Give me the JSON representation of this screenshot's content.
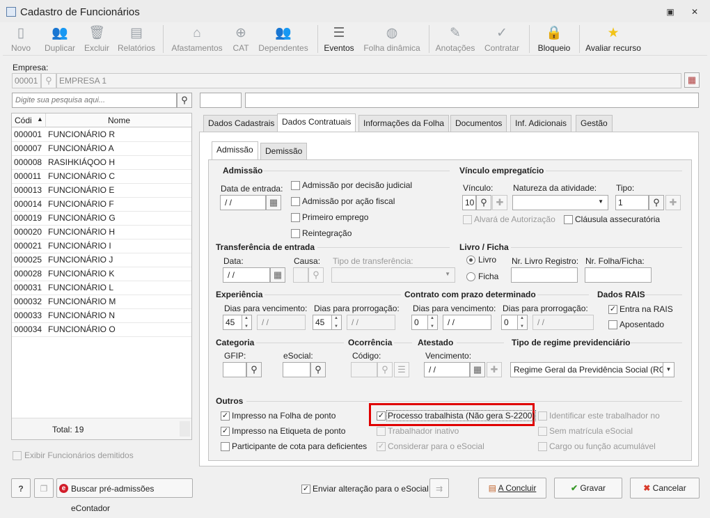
{
  "window": {
    "title": "Cadastro de Funcionários",
    "restore_icon": "▣",
    "close_icon": "✕"
  },
  "toolbar": [
    {
      "label": "Novo",
      "icon": "new-doc-icon",
      "glyph": "▯"
    },
    {
      "label": "Duplicar",
      "icon": "users-icon",
      "glyph": "👥"
    },
    {
      "label": "Excluir",
      "icon": "trash-icon",
      "glyph": "🗑"
    },
    {
      "label": "Relatórios",
      "icon": "report-icon",
      "glyph": "▤"
    },
    {
      "label": "Afastamentos",
      "icon": "house-arrow-icon",
      "glyph": "⌂"
    },
    {
      "label": "CAT",
      "icon": "plus-circle-icon",
      "glyph": "⊕"
    },
    {
      "label": "Dependentes",
      "icon": "people-icon",
      "glyph": "👥"
    },
    {
      "label": "Eventos",
      "icon": "list-icon",
      "glyph": "☰"
    },
    {
      "label": "Folha dinâmica",
      "icon": "calculator-icon",
      "glyph": "◍"
    },
    {
      "label": "Anotações",
      "icon": "note-icon",
      "glyph": "✎"
    },
    {
      "label": "Contratar",
      "icon": "contract-icon",
      "glyph": "✓"
    },
    {
      "label": "Bloqueio",
      "icon": "lock-icon",
      "glyph": "🔒"
    },
    {
      "label": "Avaliar recurso",
      "icon": "star-icon",
      "glyph": "★"
    }
  ],
  "empresa": {
    "label": "Empresa:",
    "code": "00001",
    "name": "EMPRESA 1"
  },
  "search": {
    "placeholder": "Digite sua pesquisa aqui..."
  },
  "list": {
    "col_code": "Códi",
    "col_name": "Nome",
    "rows": [
      {
        "code": "000001",
        "name": "FUNCIONÁRIO R"
      },
      {
        "code": "000007",
        "name": "FUNCIONÁRIO A"
      },
      {
        "code": "000008",
        "name": "RASIHKIÁQOO H"
      },
      {
        "code": "000011",
        "name": "FUNCIONÁRIO C"
      },
      {
        "code": "000013",
        "name": "FUNCIONÁRIO E"
      },
      {
        "code": "000014",
        "name": "FUNCIONÁRIO F"
      },
      {
        "code": "000019",
        "name": "FUNCIONÁRIO G"
      },
      {
        "code": "000020",
        "name": "FUNCIONÁRIO H"
      },
      {
        "code": "000021",
        "name": "FUNCIONÁRIO I"
      },
      {
        "code": "000025",
        "name": "FUNCIONÁRIO J"
      },
      {
        "code": "000028",
        "name": "FUNCIONÁRIO K"
      },
      {
        "code": "000031",
        "name": "FUNCIONÁRIO L"
      },
      {
        "code": "000032",
        "name": "FUNCIONÁRIO M"
      },
      {
        "code": "000033",
        "name": "FUNCIONÁRIO N"
      },
      {
        "code": "000034",
        "name": "FUNCIONÁRIO O"
      }
    ],
    "total": "Total: 19",
    "show_dismissed": "Exibir Funcionários demitidos"
  },
  "tabs": [
    "Dados Cadastrais",
    "Dados Contratuais",
    "Informações da Folha",
    "Documentos",
    "Inf. Adicionais",
    "Gestão"
  ],
  "subtabs": [
    "Admissão",
    "Demissão"
  ],
  "admissao": {
    "title": "Admissão",
    "data_label": "Data de entrada:",
    "data_value": " / /",
    "checks": [
      "Admissão por decisão judicial",
      "Admissão por ação fiscal",
      "Primeiro emprego",
      "Reintegração"
    ]
  },
  "vinculo": {
    "title": "Vínculo empregatício",
    "vinculo_label": "Vínculo:",
    "vinculo_value": "10",
    "natureza_label": "Natureza da atividade:",
    "tipo_label": "Tipo:",
    "tipo_value": "1",
    "alvara": "Alvará de Autorização",
    "clausula": "Cláusula assecuratória"
  },
  "transferencia": {
    "title": "Transferência de entrada",
    "data_label": "Data:",
    "data_value": " / /",
    "causa_label": "Causa:",
    "tipo_label": "Tipo de transferência:"
  },
  "livro": {
    "title": "Livro / Ficha",
    "opt_livro": "Livro",
    "opt_ficha": "Ficha",
    "nr_livro_label": "Nr. Livro Registro:",
    "nr_folha_label": "Nr. Folha/Ficha:"
  },
  "experiencia": {
    "title": "Experiência",
    "venc_label": "Dias para vencimento:",
    "venc_value": "45",
    "venc_date": " / /",
    "prorr_label": "Dias para prorrogação:",
    "prorr_value": "45",
    "prorr_date": " / /"
  },
  "contrato": {
    "title": "Contrato com prazo determinado",
    "venc_label": "Dias para vencimento:",
    "venc_value": "0",
    "venc_date": " / /",
    "prorr_label": "Dias para prorrogação:",
    "prorr_value": "0",
    "prorr_date": " / /"
  },
  "rais": {
    "title": "Dados RAIS",
    "entra": "Entra na RAIS",
    "aposentado": "Aposentado"
  },
  "categoria": {
    "title": "Categoria",
    "gfip": "GFIP:",
    "esocial": "eSocial:"
  },
  "ocorrencia": {
    "title": "Ocorrência",
    "codigo": "Código:"
  },
  "atestado": {
    "title": "Atestado",
    "vencimento": "Vencimento:",
    "date": " / /"
  },
  "regime": {
    "title": "Tipo de regime previdenciário",
    "value": "Regime Geral da Previdência Social (RGPS)"
  },
  "outros": {
    "title": "Outros",
    "folha": "Impresso na Folha de ponto",
    "etiqueta": "Impresso na Etiqueta de ponto",
    "cota": "Participante de cota para deficientes",
    "processo": "Processo trabalhista (Não gera S-2200)",
    "inativo": "Trabalhador inativo",
    "considerar": "Considerar para o eSocial",
    "identificar": "Identificar este trabalhador no RET",
    "sem_matricula": "Sem matrícula eSocial",
    "cargo": "Cargo ou função acumulável",
    "highlight_color": "#e00000"
  },
  "footer": {
    "help": "?",
    "buscar": "Buscar pré-admissões eContador",
    "enviar": "Enviar alteração para o eSocial",
    "concluir": "A Concluir",
    "gravar": "Gravar",
    "cancelar": "Cancelar"
  }
}
